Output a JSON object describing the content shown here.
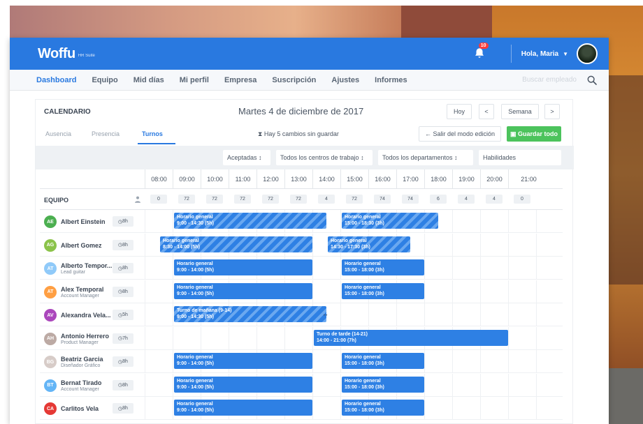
{
  "app": {
    "logo": "Woffu",
    "logo_sub": "HR Suite",
    "notifications": "10",
    "greeting": "Hola, Maria"
  },
  "nav": {
    "items": [
      "Dashboard",
      "Equipo",
      "Mid días",
      "Mi perfil",
      "Empresa",
      "Suscripción",
      "Ajustes",
      "Informes"
    ],
    "search_placeholder": "Buscar empleado"
  },
  "calendar": {
    "title": "CALENDARIO",
    "date": "Martes 4 de diciembre de 2017",
    "today_label": "Hoy",
    "prev_label": "<",
    "view_label": "Semana",
    "next_label": ">",
    "tabs": [
      "Ausencia",
      "Presencia",
      "Turnos"
    ],
    "active_tab": "Turnos",
    "changes_text": "Hay 5 cambios sin guardar",
    "exit_label": "← Salir del modo edición",
    "save_label": "Guardar todo",
    "filters": [
      "Aceptadas ↕",
      "Todos los centros de trabajo ↕",
      "Todos los departamentos ↕",
      "Habilidades"
    ],
    "hours": [
      "08:00",
      "09:00",
      "10:00",
      "11:00",
      "12:00",
      "13:00",
      "14:00",
      "15:00",
      "16:00",
      "17:00",
      "18:00",
      "19:00",
      "20:00",
      "21:00"
    ],
    "team_label": "EQUIPO",
    "counts": [
      "0",
      "72",
      "72",
      "72",
      "72",
      "72",
      "4",
      "72",
      "74",
      "74",
      "6",
      "4",
      "4",
      "0"
    ]
  },
  "employees": [
    {
      "initials": "AE",
      "name": "Albert Einstein",
      "role": "",
      "hours": "8h",
      "color": "#4caf50",
      "shifts": [
        {
          "title": "Horario general",
          "time": "9:00 - 14:30 (5h)",
          "start": 9,
          "end": 14.5,
          "striped": true
        },
        {
          "title": "Horario general",
          "time": "15:00 - 18:30 (3h)",
          "start": 15,
          "end": 18.5,
          "striped": true
        }
      ]
    },
    {
      "initials": "AG",
      "name": "Albert Gomez",
      "role": "",
      "hours": "8h",
      "color": "#8bc34a",
      "shifts": [
        {
          "title": "Horario general",
          "time": "8:30 - 14:00 (5h)",
          "start": 8.5,
          "end": 14,
          "striped": true
        },
        {
          "title": "Horario general",
          "time": "14:30 - 17:30 (3h)",
          "start": 14.5,
          "end": 17.5,
          "striped": true
        }
      ]
    },
    {
      "initials": "AT",
      "name": "Alberto Tempor...",
      "role": "Lead guitar",
      "hours": "8h",
      "color": "#90caf9",
      "shifts": [
        {
          "title": "Horario general",
          "time": "9:00 - 14:00 (5h)",
          "start": 9,
          "end": 14,
          "striped": false
        },
        {
          "title": "Horario general",
          "time": "15:00 - 18:00 (3h)",
          "start": 15,
          "end": 18,
          "striped": false
        }
      ]
    },
    {
      "initials": "AT",
      "name": "Alex Temporal",
      "role": "Account Manager",
      "hours": "8h",
      "color": "#ff9f43",
      "shifts": [
        {
          "title": "Horario general",
          "time": "9:00 - 14:00 (5h)",
          "start": 9,
          "end": 14,
          "striped": false
        },
        {
          "title": "Horario general",
          "time": "15:00 - 18:00 (3h)",
          "start": 15,
          "end": 18,
          "striped": false
        }
      ]
    },
    {
      "initials": "AV",
      "name": "Alexandra Vela...",
      "role": "",
      "hours": "5h",
      "color": "#ab47bc",
      "shifts": [
        {
          "title": "Turno de mañana (9-14)",
          "time": "9:00 - 14:30 (5h)",
          "start": 9,
          "end": 14.5,
          "striped": true
        }
      ]
    },
    {
      "initials": "AH",
      "name": "Antonio Herrero",
      "role": "Product Manager",
      "hours": "7h",
      "color": "#bcaaa4",
      "shifts": [
        {
          "title": "Turno de tarde (14-21)",
          "time": "14:00 - 21:00 (7h)",
          "start": 14,
          "end": 21,
          "striped": false
        }
      ]
    },
    {
      "initials": "BG",
      "name": "Beatriz Garcia",
      "role": "Diseñador Gráfico",
      "hours": "8h",
      "color": "#d7ccc8",
      "shifts": [
        {
          "title": "Horario general",
          "time": "9:00 - 14:00 (5h)",
          "start": 9,
          "end": 14,
          "striped": false
        },
        {
          "title": "Horario general",
          "time": "15:00 - 18:00 (3h)",
          "start": 15,
          "end": 18,
          "striped": false
        }
      ]
    },
    {
      "initials": "BT",
      "name": "Bernat Tirado",
      "role": "Account Manager",
      "hours": "8h",
      "color": "#64b5f6",
      "shifts": [
        {
          "title": "Horario general",
          "time": "9:00 - 14:00 (5h)",
          "start": 9,
          "end": 14,
          "striped": false
        },
        {
          "title": "Horario general",
          "time": "15:00 - 18:00 (3h)",
          "start": 15,
          "end": 18,
          "striped": false
        }
      ]
    },
    {
      "initials": "CA",
      "name": "Carlitos Vela",
      "role": "",
      "hours": "8h",
      "color": "#e53935",
      "shifts": [
        {
          "title": "Horario general",
          "time": "9:00 - 14:00 (5h)",
          "start": 9,
          "end": 14,
          "striped": false
        },
        {
          "title": "Horario general",
          "time": "15:00 - 18:00 (3h)",
          "start": 15,
          "end": 18,
          "striped": false
        }
      ]
    }
  ]
}
